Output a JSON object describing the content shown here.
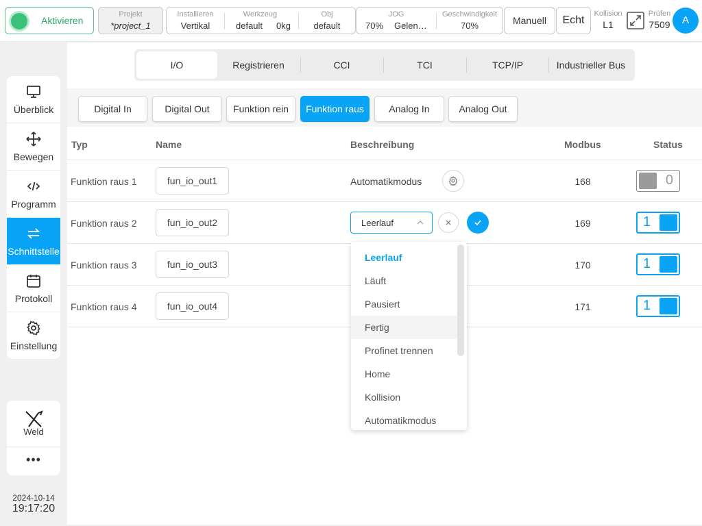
{
  "topbar": {
    "activate_label": "Aktivieren",
    "project": {
      "caption": "Projekt",
      "value": "*project_1"
    },
    "install": {
      "caption": "Installieren",
      "value": "Vertikal"
    },
    "tool": {
      "caption": "Werkzeug",
      "value": "default",
      "weight": "0kg"
    },
    "obj": {
      "caption": "Obj",
      "value": "default"
    },
    "jog": {
      "caption": "JOG",
      "percent": "70%",
      "mode": "Gelen…"
    },
    "speed": {
      "caption": "Geschwindigkeit",
      "value": "70%"
    },
    "manual_label": "Manuell",
    "real_label": "Echt",
    "collision": {
      "caption": "Kollision",
      "value": "L1"
    },
    "check": {
      "caption": "Prüfen",
      "value": "7509"
    },
    "avatar_letter": "A"
  },
  "sidebar": {
    "items": [
      {
        "label": "Überblick",
        "icon": "monitor-icon"
      },
      {
        "label": "Bewegen",
        "icon": "move-icon"
      },
      {
        "label": "Programm",
        "icon": "code-icon"
      },
      {
        "label": "Schnittstelle",
        "icon": "swap-icon"
      },
      {
        "label": "Protokoll",
        "icon": "calendar-icon"
      },
      {
        "label": "Einstellung",
        "icon": "gear-icon"
      }
    ],
    "weld_label": "Weld",
    "more_label": "•••",
    "date": "2024-10-14",
    "time": "19:17:20"
  },
  "tabs": [
    "I/O",
    "Registrieren",
    "CCI",
    "TCI",
    "TCP/IP",
    "Industrieller Bus"
  ],
  "subtabs": [
    "Digital In",
    "Digital Out",
    "Funktion rein",
    "Funktion raus",
    "Analog In",
    "Analog Out"
  ],
  "table": {
    "headers": {
      "typ": "Typ",
      "name": "Name",
      "desc": "Beschreibung",
      "modbus": "Modbus",
      "status": "Status"
    },
    "rows": [
      {
        "typ": "Funktion raus 1",
        "name": "fun_io_out1",
        "desc": "Automatikmodus",
        "modbus": "168",
        "status": "0"
      },
      {
        "typ": "Funktion raus 2",
        "name": "fun_io_out2",
        "desc": "Leerlauf",
        "modbus": "169",
        "status": "1"
      },
      {
        "typ": "Funktion raus 3",
        "name": "fun_io_out3",
        "desc": "",
        "modbus": "170",
        "status": "1"
      },
      {
        "typ": "Funktion raus 4",
        "name": "fun_io_out4",
        "desc": "",
        "modbus": "171",
        "status": "1"
      }
    ]
  },
  "dropdown": {
    "options": [
      "Leerlauf",
      "Läuft",
      "Pausiert",
      "Fertig",
      "Profinet trennen",
      "Home",
      "Kollision",
      "Automatikmodus"
    ],
    "selected": "Leerlauf",
    "hovered": "Fertig"
  },
  "colors": {
    "accent": "#0aa4f6",
    "active_green": "#3bc27a"
  }
}
